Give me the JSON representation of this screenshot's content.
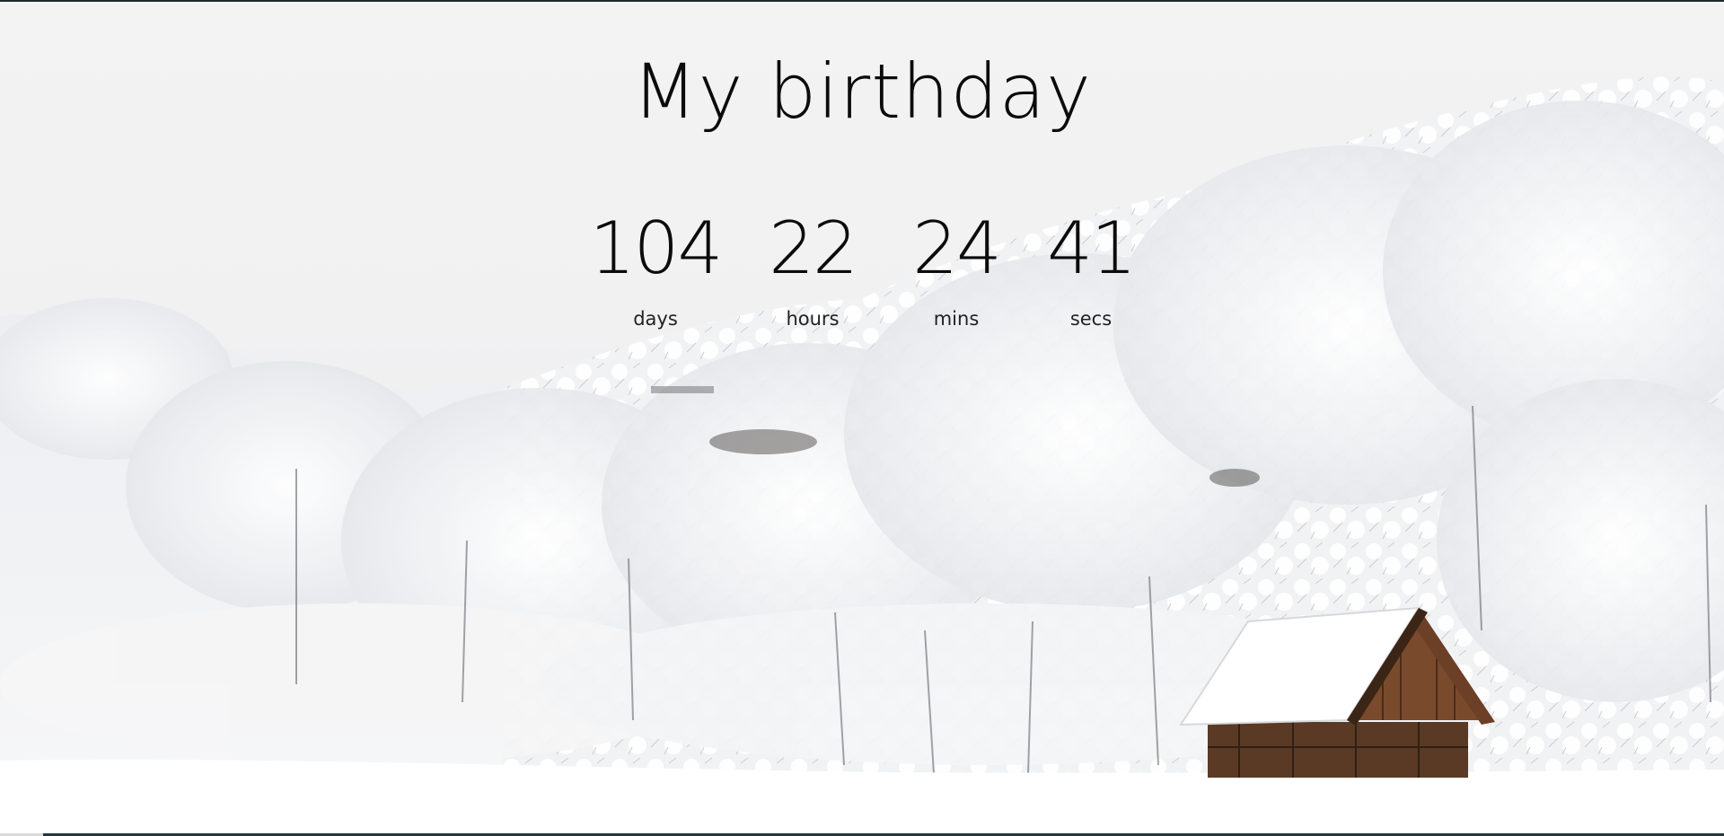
{
  "title": "My birthday",
  "countdown": [
    {
      "value": "104",
      "label": "days"
    },
    {
      "value": "22",
      "label": "hours"
    },
    {
      "value": "24",
      "label": "mins"
    },
    {
      "value": "41",
      "label": "secs"
    }
  ],
  "background": {
    "image": "snow-forest-cabin",
    "colors": {
      "sky": "#f3f3f3",
      "snow": "#ffffff",
      "tree_shadow": "#c9ccd2",
      "cabin_wood": "#6b4026"
    }
  }
}
